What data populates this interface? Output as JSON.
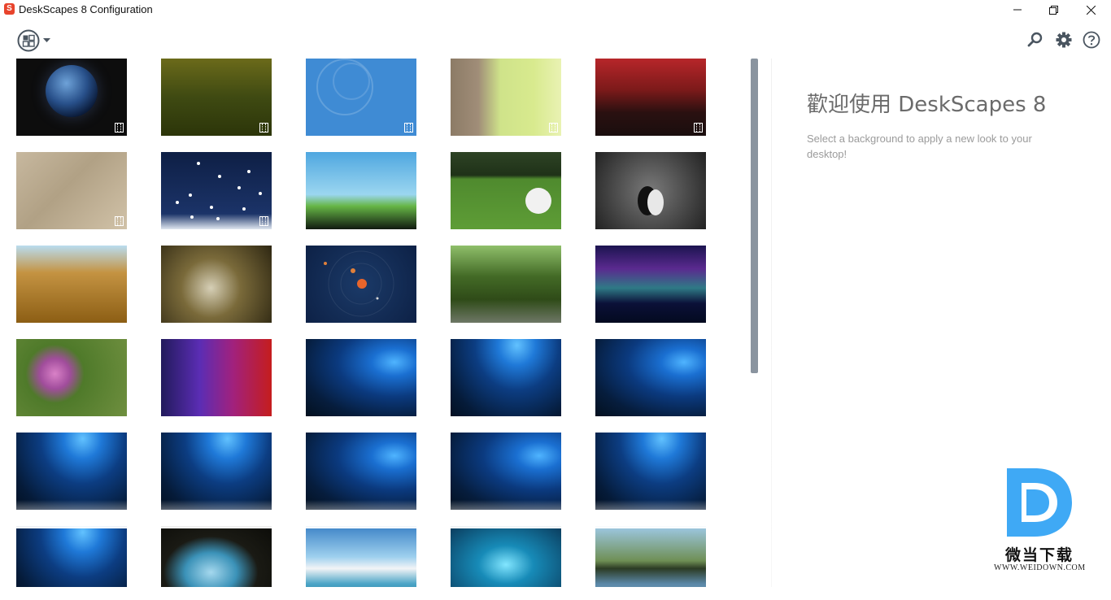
{
  "window": {
    "title": "DeskScapes 8 Configuration",
    "app_icon_glyph": "S"
  },
  "toolbar": {
    "view_icon": "grid-view-icon",
    "search_icon": "search-icon",
    "settings_icon": "gear-icon",
    "help_icon": "help-icon"
  },
  "welcome": {
    "title": "歡迎使用 DeskScapes 8",
    "text": "Select a background to apply a new look to your desktop!"
  },
  "watermark": {
    "name": "微当下载",
    "url": "WWW.WEIDOWN.COM"
  },
  "thumbnails": [
    {
      "subject": "earth",
      "video": true
    },
    {
      "subject": "pine",
      "video": true
    },
    {
      "subject": "blue-rings",
      "video": true
    },
    {
      "subject": "bark",
      "video": true
    },
    {
      "subject": "city",
      "video": true
    },
    {
      "subject": "sand",
      "video": true
    },
    {
      "subject": "night-snow",
      "video": true
    },
    {
      "subject": "tree-island",
      "video": false
    },
    {
      "subject": "golf",
      "video": false
    },
    {
      "subject": "cat",
      "video": false
    },
    {
      "subject": "wheat",
      "video": false
    },
    {
      "subject": "feather",
      "video": false
    },
    {
      "subject": "solar",
      "video": false
    },
    {
      "subject": "path",
      "video": false
    },
    {
      "subject": "aurora",
      "video": false
    },
    {
      "subject": "flower",
      "video": false
    },
    {
      "subject": "wave",
      "video": false
    },
    {
      "subject": "win10",
      "video": false
    },
    {
      "subject": "win10b",
      "video": false
    },
    {
      "subject": "win10",
      "video": false
    },
    {
      "subject": "win10b",
      "video": false
    },
    {
      "subject": "win10b",
      "video": false
    },
    {
      "subject": "win10",
      "video": false
    },
    {
      "subject": "win10",
      "video": false
    },
    {
      "subject": "win10b",
      "video": false
    },
    {
      "subject": "win10b",
      "video": false
    },
    {
      "subject": "cave",
      "video": false
    },
    {
      "subject": "beach",
      "video": false
    },
    {
      "subject": "icecave",
      "video": false
    },
    {
      "subject": "lake",
      "video": false
    }
  ],
  "colors": {
    "scrollbar": "#8a949f",
    "accent": "#3fa9f5"
  }
}
